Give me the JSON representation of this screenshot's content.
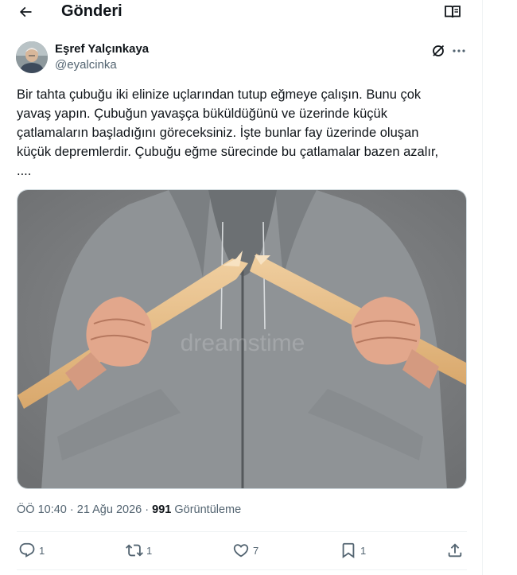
{
  "header": {
    "title": "Gönderi",
    "back_icon": "arrow-left-icon",
    "reader_icon": "reader-book-icon"
  },
  "author": {
    "name": "Eşref Yalçınkaya",
    "handle": "@eyalcinka"
  },
  "tweet": {
    "text": "Bir tahta çubuğu iki elinize uçlarından tutup eğmeye çalışın. Bunu çok\nyavaş yapın. Çubuğun yavaşça büküldüğünü ve üzerinde küçük\nçatlamaların başladığını göreceksiniz. İşte bunlar fay üzerinde oluşan\nküçük depremlerdir. Çubuğu eğme sürecinde bu çatlamalar bazen azalır,\n...."
  },
  "media": {
    "watermark": "dreamstime"
  },
  "meta": {
    "time": "ÖÖ 10:40",
    "sep1": "·",
    "date": "21 Ağu 2026",
    "sep2": "·",
    "views": "991",
    "views_label": "Görüntüleme"
  },
  "actions": {
    "replies": "1",
    "reposts": "1",
    "likes": "7",
    "bookmarks": "1"
  },
  "colors": {
    "text_primary": "#0f1419",
    "text_secondary": "#536471",
    "divider": "#eff3f4"
  }
}
